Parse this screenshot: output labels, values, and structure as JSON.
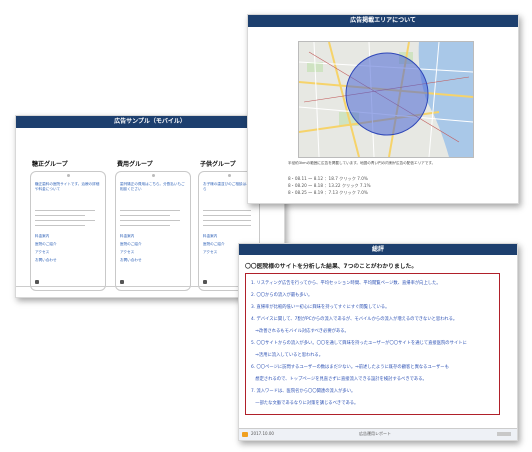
{
  "slide_mobile": {
    "header": "広告サンプル（モバイル）",
    "groups": [
      {
        "title": "糖正グループ",
        "snippet": "糖正歯科の医院サイトです。治療の詳細や料金について",
        "links": [
          "料金案内",
          "医院のご紹介",
          "アクセス",
          "お問い合わせ"
        ]
      },
      {
        "title": "費用グループ",
        "snippet": "歯列矯正の費用はこちら。分割払いもご相談ください",
        "links": [
          "料金案内",
          "医院のご紹介",
          "アクセス",
          "お問い合わせ"
        ]
      },
      {
        "title": "子供グループ",
        "snippet": "お子様の歯並びのご相談はこちら",
        "links": [
          "料金案内",
          "医院のご紹介",
          "アクセス"
        ]
      }
    ]
  },
  "slide_area": {
    "header": "広告掲載エリアについて",
    "description": "半径約3kmの範囲に広告を掲載しています。地図の青い円の内側が広告の配信エリアです。",
    "schedule": [
      "8・08.11 〜 8.12 ：18.7 クリック 7.0%",
      "8・08.20 〜 8.18 ：13.22 クリック 7.1%",
      "8・08.25 〜 8.19 ：7.13 クリック 7.0%"
    ]
  },
  "slide_eval": {
    "header": "総評",
    "intro": "〇〇医院様のサイトを分析した結果、7つのことがわかりました。",
    "items": [
      "1. リスティング広告を行ってから、平均セッション時間、平均閲覧ページ数、直帰率が向上した。",
      "2. 〇〇からの流入が最も多い。",
      "3. 直帰率が比較的低い＝初心に興味を持ってすぐにすぐ閲覧している。",
      "4. デバイスに関して、7割がPCからの流入であるが、モバイルからの流入が増えるのできないと思われる。",
      "　⇒改善されるもモバイル対応すべき必要がある。",
      "5. 〇〇サイトからの流入が多い。〇〇を通して興味を持ったユーザーが〇〇サイトを通じて直接医院のサイトに",
      "　⇒活用に流入していると思われる。",
      "6. 〇〇ページに訪問するユーザーの数はまだ少ない。⇒前述したように既存の顧客と異なるユーザーも",
      "　想定されるので、トップページを見直さずに直接流入できる設計を検討するべきである。",
      "7. 流入ワードは、医院名から〇〇関連の流入が多い。",
      "　一部たな文脈であるなりに対策を講じるべきである。"
    ],
    "footer_left": "2017.10.00",
    "footer_center": "広告運用レポート"
  }
}
